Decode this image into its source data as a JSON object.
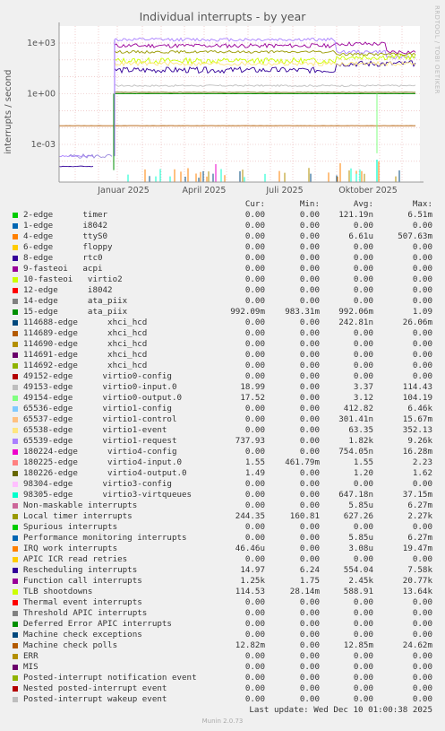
{
  "title": "Individual interrupts - by year",
  "side_note": "RRDTOOL / TOBI OETIKER",
  "ylabel": "interrupts / second",
  "columns": [
    "Cur:",
    "Min:",
    "Avg:",
    "Max:"
  ],
  "chart_data": {
    "type": "line",
    "scale": "log",
    "ylim": [
      3e-05,
      5000
    ],
    "y_ticks": [
      "1e+03",
      "1e+00",
      "1e-03"
    ],
    "x_ticks": [
      "Januar 2025",
      "April 2025",
      "Juli 2025",
      "Oktober 2025"
    ],
    "grid": true
  },
  "legend": [
    {
      "label": "2-edge      timer",
      "color": "#00cc00",
      "cur": "0.00",
      "min": "0.00",
      "avg": "121.19n",
      "max": "6.51m"
    },
    {
      "label": "1-edge      i8042",
      "color": "#0066b3",
      "cur": "0.00",
      "min": "0.00",
      "avg": "0.00",
      "max": "0.00"
    },
    {
      "label": "4-edge      ttyS0",
      "color": "#ff8000",
      "cur": "0.00",
      "min": "0.00",
      "avg": "6.61u",
      "max": "507.63m"
    },
    {
      "label": "6-edge      floppy",
      "color": "#ffcc00",
      "cur": "0.00",
      "min": "0.00",
      "avg": "0.00",
      "max": "0.00"
    },
    {
      "label": "8-edge      rtc0",
      "color": "#330099",
      "cur": "0.00",
      "min": "0.00",
      "avg": "0.00",
      "max": "0.00"
    },
    {
      "label": "9-fasteoi   acpi",
      "color": "#990099",
      "cur": "0.00",
      "min": "0.00",
      "avg": "0.00",
      "max": "0.00"
    },
    {
      "label": "10-fasteoi   virtio2",
      "color": "#ccff00",
      "cur": "0.00",
      "min": "0.00",
      "avg": "0.00",
      "max": "0.00"
    },
    {
      "label": "12-edge      i8042",
      "color": "#ff0000",
      "cur": "0.00",
      "min": "0.00",
      "avg": "0.00",
      "max": "0.00"
    },
    {
      "label": "14-edge      ata_piix",
      "color": "#808080",
      "cur": "0.00",
      "min": "0.00",
      "avg": "0.00",
      "max": "0.00"
    },
    {
      "label": "15-edge      ata_piix",
      "color": "#008f00",
      "cur": "992.09m",
      "min": "983.31m",
      "avg": "992.06m",
      "max": "1.09"
    },
    {
      "label": "114688-edge      xhci_hcd",
      "color": "#00487d",
      "cur": "0.00",
      "min": "0.00",
      "avg": "242.81n",
      "max": "26.06m"
    },
    {
      "label": "114689-edge      xhci_hcd",
      "color": "#b35a00",
      "cur": "0.00",
      "min": "0.00",
      "avg": "0.00",
      "max": "0.00"
    },
    {
      "label": "114690-edge      xhci_hcd",
      "color": "#b38f00",
      "cur": "0.00",
      "min": "0.00",
      "avg": "0.00",
      "max": "0.00"
    },
    {
      "label": "114691-edge      xhci_hcd",
      "color": "#6b006b",
      "cur": "0.00",
      "min": "0.00",
      "avg": "0.00",
      "max": "0.00"
    },
    {
      "label": "114692-edge      xhci_hcd",
      "color": "#8fb300",
      "cur": "0.00",
      "min": "0.00",
      "avg": "0.00",
      "max": "0.00"
    },
    {
      "label": "49152-edge      virtio0-config",
      "color": "#b30000",
      "cur": "0.00",
      "min": "0.00",
      "avg": "0.00",
      "max": "0.00"
    },
    {
      "label": "49153-edge      virtio0-input.0",
      "color": "#bebebe",
      "cur": "18.99",
      "min": "0.00",
      "avg": "3.37",
      "max": "114.43"
    },
    {
      "label": "49154-edge      virtio0-output.0",
      "color": "#80ff80",
      "cur": "17.52",
      "min": "0.00",
      "avg": "3.12",
      "max": "104.19"
    },
    {
      "label": "65536-edge      virtio1-config",
      "color": "#80c9ff",
      "cur": "0.00",
      "min": "0.00",
      "avg": "412.82",
      "max": "6.46k"
    },
    {
      "label": "65537-edge      virtio1-control",
      "color": "#ffc080",
      "cur": "0.00",
      "min": "0.00",
      "avg": "301.41n",
      "max": "15.67m"
    },
    {
      "label": "65538-edge      virtio1-event",
      "color": "#ffe680",
      "cur": "0.00",
      "min": "0.00",
      "avg": "63.35",
      "max": "352.13"
    },
    {
      "label": "65539-edge      virtio1-request",
      "color": "#aa80ff",
      "cur": "737.93",
      "min": "0.00",
      "avg": "1.82k",
      "max": "9.26k"
    },
    {
      "label": "180224-edge      virtio4-config",
      "color": "#ee00cc",
      "cur": "0.00",
      "min": "0.00",
      "avg": "754.05n",
      "max": "16.28m"
    },
    {
      "label": "180225-edge      virtio4-input.0",
      "color": "#ff8080",
      "cur": "1.55",
      "min": "461.79m",
      "avg": "1.55",
      "max": "2.23"
    },
    {
      "label": "180226-edge      virtio4-output.0",
      "color": "#666600",
      "cur": "1.49",
      "min": "0.00",
      "avg": "1.20",
      "max": "1.62"
    },
    {
      "label": "98304-edge      virtio3-config",
      "color": "#ffbfff",
      "cur": "0.00",
      "min": "0.00",
      "avg": "0.00",
      "max": "0.00"
    },
    {
      "label": "98305-edge      virtio3-virtqueues",
      "color": "#00ffcc",
      "cur": "0.00",
      "min": "0.00",
      "avg": "647.18n",
      "max": "37.15m"
    },
    {
      "label": "Non-maskable interrupts",
      "color": "#cc6699",
      "cur": "0.00",
      "min": "0.00",
      "avg": "5.85u",
      "max": "6.27m"
    },
    {
      "label": "Local timer interrupts",
      "color": "#999900",
      "cur": "244.35",
      "min": "160.81",
      "avg": "627.26",
      "max": "2.27k"
    },
    {
      "label": "Spurious interrupts",
      "color": "#00cc00",
      "cur": "0.00",
      "min": "0.00",
      "avg": "0.00",
      "max": "0.00"
    },
    {
      "label": "Performance monitoring interrupts",
      "color": "#0066b3",
      "cur": "0.00",
      "min": "0.00",
      "avg": "5.85u",
      "max": "6.27m"
    },
    {
      "label": "IRQ work interrupts",
      "color": "#ff8000",
      "cur": "46.46u",
      "min": "0.00",
      "avg": "3.08u",
      "max": "19.47m"
    },
    {
      "label": "APIC ICR read retries",
      "color": "#ffcc00",
      "cur": "0.00",
      "min": "0.00",
      "avg": "0.00",
      "max": "0.00"
    },
    {
      "label": "Rescheduling interrupts",
      "color": "#330099",
      "cur": "14.97",
      "min": "6.24",
      "avg": "554.04",
      "max": "7.58k"
    },
    {
      "label": "Function call interrupts",
      "color": "#990099",
      "cur": "1.25k",
      "min": "1.75",
      "avg": "2.45k",
      "max": "20.77k"
    },
    {
      "label": "TLB shootdowns",
      "color": "#ccff00",
      "cur": "114.53",
      "min": "28.14m",
      "avg": "588.91",
      "max": "13.64k"
    },
    {
      "label": "Thermal event interrupts",
      "color": "#ff0000",
      "cur": "0.00",
      "min": "0.00",
      "avg": "0.00",
      "max": "0.00"
    },
    {
      "label": "Threshold APIC interrupts",
      "color": "#808080",
      "cur": "0.00",
      "min": "0.00",
      "avg": "0.00",
      "max": "0.00"
    },
    {
      "label": "Deferred Error APIC interrupts",
      "color": "#008f00",
      "cur": "0.00",
      "min": "0.00",
      "avg": "0.00",
      "max": "0.00"
    },
    {
      "label": "Machine check exceptions",
      "color": "#00487d",
      "cur": "0.00",
      "min": "0.00",
      "avg": "0.00",
      "max": "0.00"
    },
    {
      "label": "Machine check polls",
      "color": "#b35a00",
      "cur": "12.82m",
      "min": "0.00",
      "avg": "12.85m",
      "max": "24.62m"
    },
    {
      "label": "ERR",
      "color": "#b38f00",
      "cur": "0.00",
      "min": "0.00",
      "avg": "0.00",
      "max": "0.00"
    },
    {
      "label": "MIS",
      "color": "#6b006b",
      "cur": "0.00",
      "min": "0.00",
      "avg": "0.00",
      "max": "0.00"
    },
    {
      "label": "Posted-interrupt notification event",
      "color": "#8fb300",
      "cur": "0.00",
      "min": "0.00",
      "avg": "0.00",
      "max": "0.00"
    },
    {
      "label": "Nested posted-interrupt event",
      "color": "#b30000",
      "cur": "0.00",
      "min": "0.00",
      "avg": "0.00",
      "max": "0.00"
    },
    {
      "label": "Posted-interrupt wakeup event",
      "color": "#bebebe",
      "cur": "0.00",
      "min": "0.00",
      "avg": "0.00",
      "max": "0.00"
    }
  ],
  "footer": "Last update: Wed Dec 10 01:00:38 2025",
  "version": "Munin 2.0.73"
}
